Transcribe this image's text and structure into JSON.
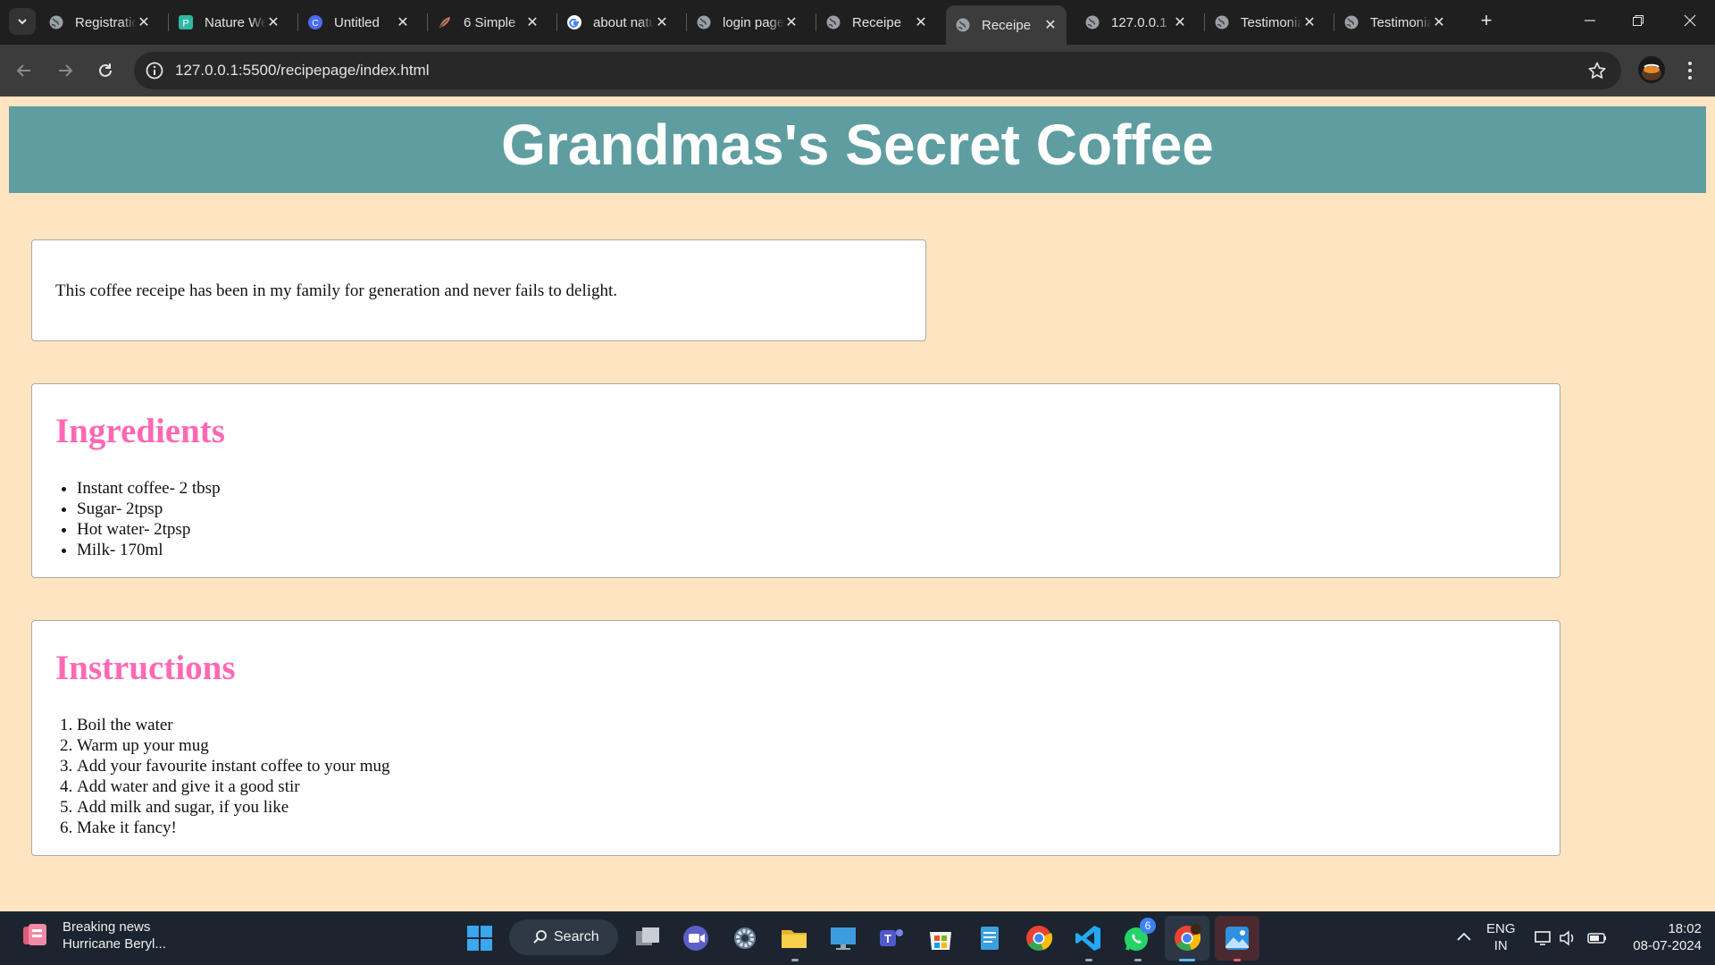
{
  "browser": {
    "tabs": [
      {
        "title": "Registration Form",
        "favicon": "globe-icon"
      },
      {
        "title": "Nature Website",
        "favicon": "p-logo-icon"
      },
      {
        "title": "Untitled",
        "favicon": "canva-icon"
      },
      {
        "title": "6 Simple",
        "favicon": "feather-icon"
      },
      {
        "title": "about nature",
        "favicon": "google-icon"
      },
      {
        "title": "login page",
        "favicon": "globe-icon"
      },
      {
        "title": "Receipe",
        "favicon": "globe-icon"
      },
      {
        "title": "Receipe",
        "favicon": "globe-icon",
        "active": true
      },
      {
        "title": "127.0.0.1",
        "favicon": "globe-icon"
      },
      {
        "title": "Testimonial",
        "favicon": "globe-icon"
      },
      {
        "title": "Testimonial",
        "favicon": "globe-icon"
      }
    ],
    "url": "127.0.0.1:5500/recipepage/index.html"
  },
  "page": {
    "header_title": "Grandmas's Secret Coffee",
    "intro": "This coffee receipe has been in my family for generation and never fails to delight.",
    "ingredients_heading": "Ingredients",
    "ingredients": [
      "Instant coffee- 2 tbsp",
      "Sugar- 2tpsp",
      "Hot water- 2tpsp",
      "Milk- 170ml"
    ],
    "instructions_heading": "Instructions",
    "instructions": [
      "Boil the water",
      "Warm up your mug",
      "Add your favourite instant coffee to your mug",
      "Add water and give it a good stir",
      "Add milk and sugar, if you like",
      "Make it fancy!"
    ],
    "colors": {
      "header_bg": "#5f9ea0",
      "page_bg": "#ffe4c1",
      "heading": "#ff69b4"
    }
  },
  "taskbar": {
    "news_title": "Breaking news",
    "news_subtitle": "Hurricane Beryl...",
    "search_label": "Search",
    "whatsapp_badge": "6",
    "lang_top": "ENG",
    "lang_bottom": "IN",
    "time": "18:02",
    "date": "08-07-2024"
  }
}
